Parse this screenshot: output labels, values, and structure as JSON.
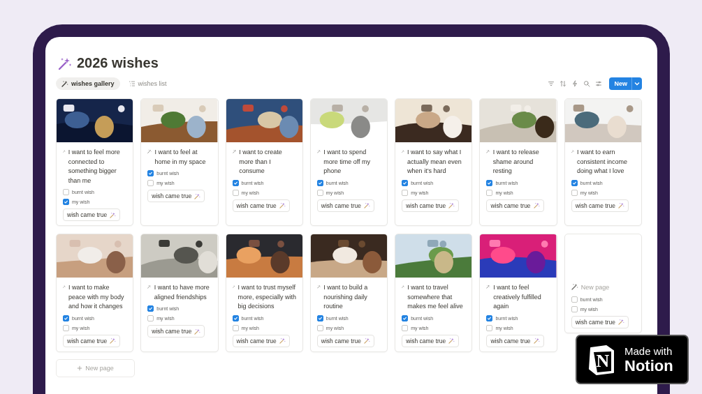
{
  "page": {
    "title": "2026 wishes"
  },
  "views": [
    {
      "label": "wishes gallery",
      "selected": true
    },
    {
      "label": "wishes list",
      "selected": false
    }
  ],
  "toolbar": {
    "new_button": "New"
  },
  "cards": [
    {
      "kind": "wish",
      "title": "I want to feel more connected to something bigger than me",
      "properties": [
        {
          "label": "burnt wish",
          "checked": false
        },
        {
          "label": "my wish",
          "checked": true
        }
      ],
      "tag": "wish came true"
    },
    {
      "kind": "wish",
      "title": "I want to feel at home in my space",
      "properties": [
        {
          "label": "burnt wish",
          "checked": true
        },
        {
          "label": "my wish",
          "checked": false
        }
      ],
      "tag": "wish came true"
    },
    {
      "kind": "wish",
      "title": "I want to create more than I consume",
      "properties": [
        {
          "label": "burnt wish",
          "checked": true
        },
        {
          "label": "my wish",
          "checked": false
        }
      ],
      "tag": "wish came true"
    },
    {
      "kind": "wish",
      "title": "I want to spend more time off my phone",
      "properties": [
        {
          "label": "burnt wish",
          "checked": true
        },
        {
          "label": "my wish",
          "checked": false
        }
      ],
      "tag": "wish came true"
    },
    {
      "kind": "wish",
      "title": "I want to say what I actually mean even when it’s hard",
      "properties": [
        {
          "label": "burnt wish",
          "checked": true
        },
        {
          "label": "my wish",
          "checked": false
        }
      ],
      "tag": "wish came true"
    },
    {
      "kind": "wish",
      "title": "I want to release shame around resting",
      "properties": [
        {
          "label": "burnt wish",
          "checked": true
        },
        {
          "label": "my wish",
          "checked": false
        }
      ],
      "tag": "wish came true"
    },
    {
      "kind": "wish",
      "title": "I want to earn consistent income doing what I love",
      "properties": [
        {
          "label": "burnt wish",
          "checked": true
        },
        {
          "label": "my wish",
          "checked": false
        }
      ],
      "tag": "wish came true"
    },
    {
      "kind": "wish",
      "title": "I want to make peace with my body and how it changes",
      "properties": [
        {
          "label": "burnt wish",
          "checked": true
        },
        {
          "label": "my wish",
          "checked": false
        }
      ],
      "tag": "wish came true"
    },
    {
      "kind": "wish",
      "title": "I want to have more aligned friendships",
      "properties": [
        {
          "label": "burnt wish",
          "checked": true
        },
        {
          "label": "my wish",
          "checked": false
        }
      ],
      "tag": "wish came true"
    },
    {
      "kind": "wish",
      "title": "I want to trust myself more, especially with big decisions",
      "properties": [
        {
          "label": "burnt wish",
          "checked": true
        },
        {
          "label": "my wish",
          "checked": false
        }
      ],
      "tag": "wish came true"
    },
    {
      "kind": "wish",
      "title": "I want to build a nourishing daily routine",
      "properties": [
        {
          "label": "burnt wish",
          "checked": true
        },
        {
          "label": "my wish",
          "checked": false
        }
      ],
      "tag": "wish came true"
    },
    {
      "kind": "wish",
      "title": "I want to travel somewhere that makes me feel alive",
      "properties": [
        {
          "label": "burnt wish",
          "checked": true
        },
        {
          "label": "my wish",
          "checked": false
        }
      ],
      "tag": "wish came true"
    },
    {
      "kind": "wish",
      "title": "I want to feel creatively fulfilled again",
      "properties": [
        {
          "label": "burnt wish",
          "checked": true
        },
        {
          "label": "my wish",
          "checked": false
        }
      ],
      "tag": "wish came true"
    },
    {
      "kind": "untitled",
      "title": "New page",
      "properties": [
        {
          "label": "burnt wish",
          "checked": false
        },
        {
          "label": "my wish",
          "checked": false
        }
      ],
      "tag": "wish came true"
    }
  ],
  "new_page_button": "New page",
  "badge": {
    "logo_letter": "N",
    "line_1": "Made with",
    "line_2": "Notion"
  }
}
